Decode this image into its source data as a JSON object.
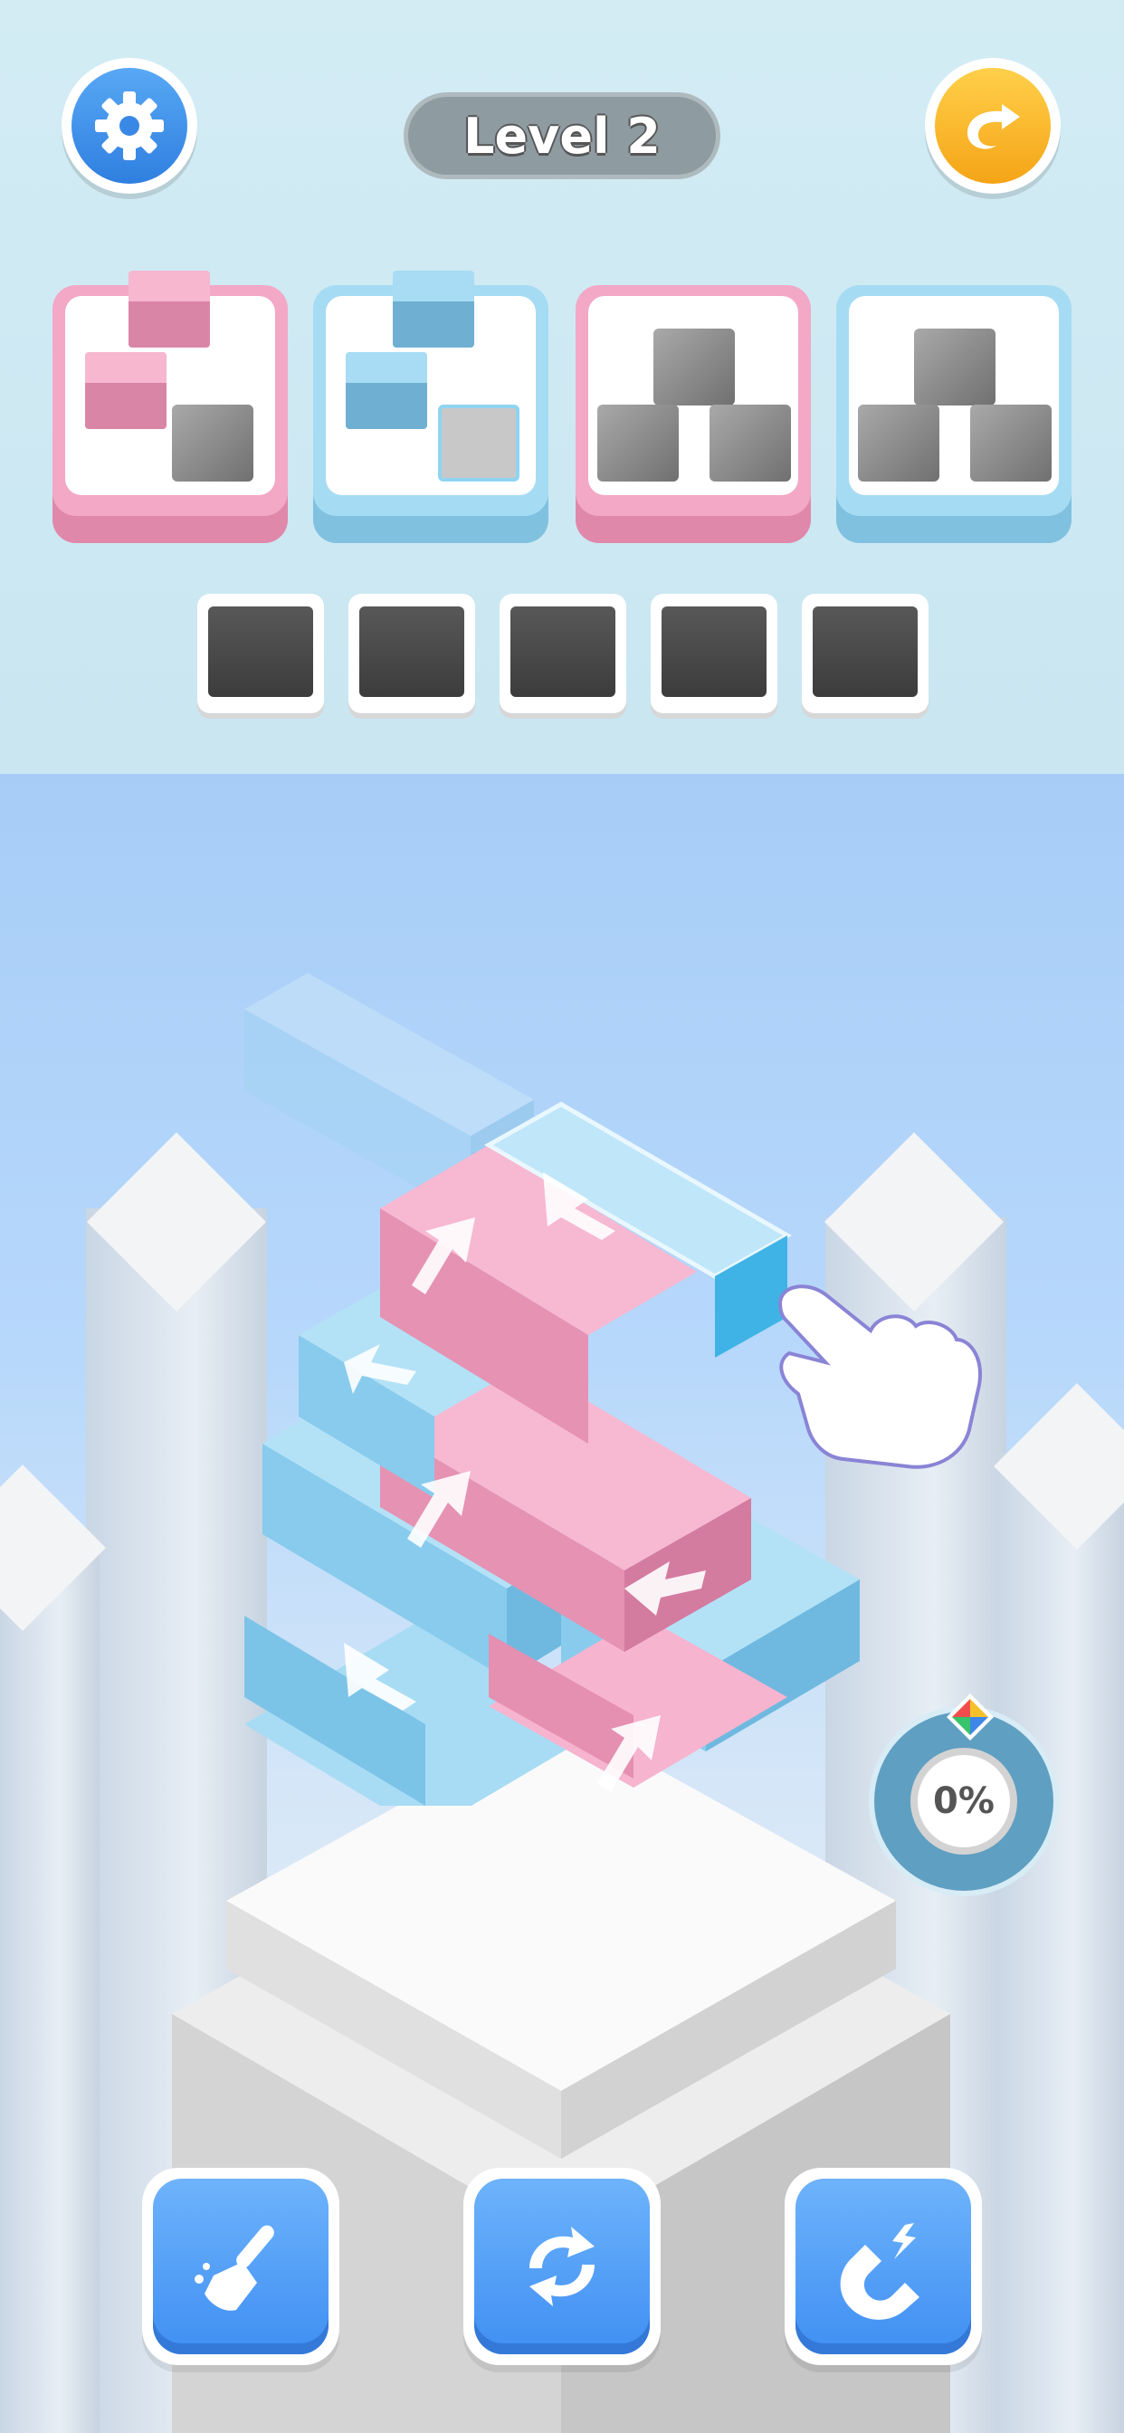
{
  "header": {
    "level_label": "Level 2",
    "settings_icon": "gear-icon",
    "undo_icon": "undo-arrow-icon"
  },
  "target_cards": [
    {
      "color": "pink",
      "filled": 2,
      "total": 3
    },
    {
      "color": "blue",
      "filled": 2,
      "total": 3
    },
    {
      "color": "pink",
      "filled": 0,
      "total": 3
    },
    {
      "color": "blue",
      "filled": 0,
      "total": 3
    }
  ],
  "holding_slots": [
    {
      "state": "empty"
    },
    {
      "state": "empty"
    },
    {
      "state": "empty"
    },
    {
      "state": "empty"
    },
    {
      "state": "empty"
    }
  ],
  "progress": {
    "label": "0%",
    "value": 0
  },
  "tools": [
    {
      "name": "broom",
      "icon": "broom-icon"
    },
    {
      "name": "shuffle",
      "icon": "shuffle-icon"
    },
    {
      "name": "magnet",
      "icon": "magnet-icon"
    }
  ],
  "colors": {
    "pink": "#f3a8c6",
    "blue": "#a6dcf3",
    "button_blue": "#4a96f5",
    "undo_orange": "#f7b21f"
  }
}
